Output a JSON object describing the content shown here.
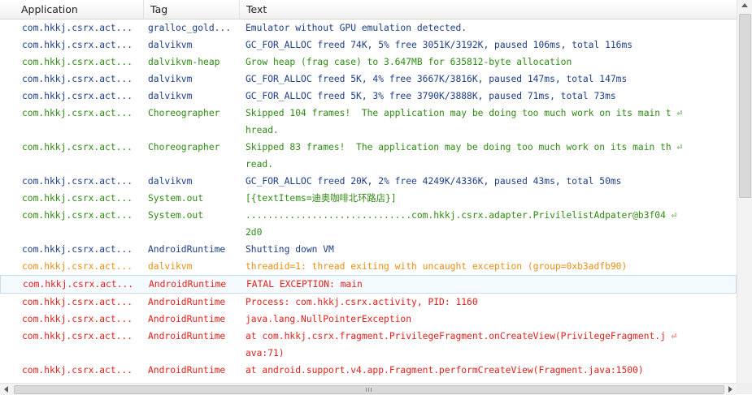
{
  "columns": {
    "application": "Application",
    "tag": "Tag",
    "text": "Text"
  },
  "colors": {
    "debug": "#1c3e8a",
    "info": "#2e8b12",
    "warn": "#e98f16",
    "error": "#e2201b"
  },
  "rows": [
    {
      "app": "com.hkkj.csrx.act...",
      "tag": "gralloc_gold...",
      "text": "Emulator without GPU emulation detected.",
      "level": "debug"
    },
    {
      "app": "com.hkkj.csrx.act...",
      "tag": "dalvikvm",
      "text": "GC_FOR_ALLOC freed 74K, 5% free 3051K/3192K, paused 106ms, total 116ms",
      "level": "debug"
    },
    {
      "app": "com.hkkj.csrx.act...",
      "tag": "dalvikvm-heap",
      "text": "Grow heap (frag case) to 3.647MB for 635812-byte allocation",
      "level": "info"
    },
    {
      "app": "com.hkkj.csrx.act...",
      "tag": "dalvikvm",
      "text": "GC_FOR_ALLOC freed 5K, 4% free 3667K/3816K, paused 147ms, total 147ms",
      "level": "debug"
    },
    {
      "app": "com.hkkj.csrx.act...",
      "tag": "dalvikvm",
      "text": "GC_FOR_ALLOC freed 5K, 3% free 3790K/3888K, paused 71ms, total 73ms",
      "level": "debug"
    },
    {
      "app": "com.hkkj.csrx.act...",
      "tag": "Choreographer",
      "text": "Skipped 104 frames!  The application may be doing too much work on its main t ⏎\nhread.",
      "level": "info"
    },
    {
      "app": "com.hkkj.csrx.act...",
      "tag": "Choreographer",
      "text": "Skipped 83 frames!  The application may be doing too much work on its main th ⏎\nread.",
      "level": "info"
    },
    {
      "app": "com.hkkj.csrx.act...",
      "tag": "dalvikvm",
      "text": "GC_FOR_ALLOC freed 20K, 2% free 4249K/4336K, paused 43ms, total 50ms",
      "level": "debug"
    },
    {
      "app": "com.hkkj.csrx.act...",
      "tag": "System.out",
      "text": "[{textItems=迪奥咖啡北环路店}]",
      "level": "info"
    },
    {
      "app": "com.hkkj.csrx.act...",
      "tag": "System.out",
      "text": "..............................com.hkkj.csrx.adapter.PrivilelistAdpater@b3f04 ⏎\n2d0",
      "level": "info"
    },
    {
      "app": "com.hkkj.csrx.act...",
      "tag": "AndroidRuntime",
      "text": "Shutting down VM",
      "level": "debug"
    },
    {
      "app": "com.hkkj.csrx.act...",
      "tag": "dalvikvm",
      "text": "threadid=1: thread exiting with uncaught exception (group=0xb3adfb90)",
      "level": "warn"
    },
    {
      "app": "com.hkkj.csrx.act...",
      "tag": "AndroidRuntime",
      "text": "FATAL EXCEPTION: main",
      "level": "error",
      "selected": true
    },
    {
      "app": "com.hkkj.csrx.act...",
      "tag": "AndroidRuntime",
      "text": "Process: com.hkkj.csrx.activity, PID: 1160",
      "level": "error"
    },
    {
      "app": "com.hkkj.csrx.act...",
      "tag": "AndroidRuntime",
      "text": "java.lang.NullPointerException",
      "level": "error"
    },
    {
      "app": "com.hkkj.csrx.act...",
      "tag": "AndroidRuntime",
      "text": "at com.hkkj.csrx.fragment.PrivilegeFragment.onCreateView(PrivilegeFragment.j ⏎\nava:71)",
      "level": "error"
    },
    {
      "app": "com.hkkj.csrx.act...",
      "tag": "AndroidRuntime",
      "text": "at android.support.v4.app.Fragment.performCreateView(Fragment.java:1500)",
      "level": "error"
    }
  ]
}
